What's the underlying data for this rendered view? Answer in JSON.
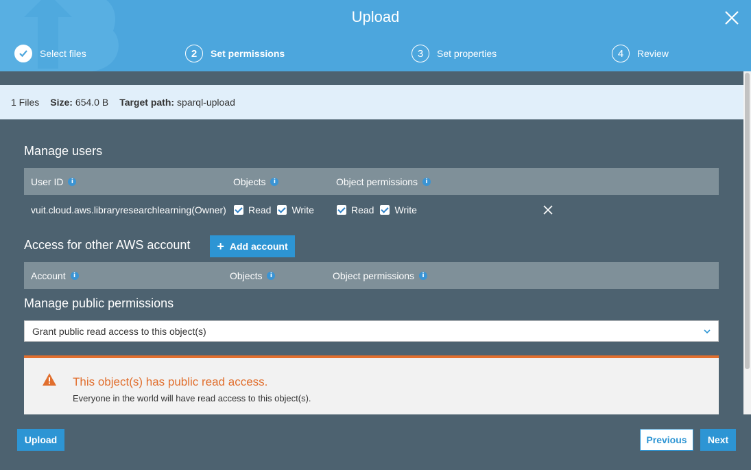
{
  "header": {
    "title": "Upload",
    "steps": [
      {
        "number": "",
        "label": "Select files",
        "state": "done"
      },
      {
        "number": "2",
        "label": "Set permissions",
        "state": "active"
      },
      {
        "number": "3",
        "label": "Set properties",
        "state": "pending"
      },
      {
        "number": "4",
        "label": "Review",
        "state": "pending"
      }
    ]
  },
  "infobar": {
    "files": "1 Files",
    "size_label": "Size:",
    "size_value": "654.0 B",
    "target_label": "Target path:",
    "target_value": "sparql-upload"
  },
  "manage_users": {
    "title": "Manage users",
    "columns": [
      "User ID",
      "Objects",
      "Object permissions"
    ],
    "rows": [
      {
        "user_id": "vuit.cloud.aws.libraryresearchlearning(Owner)",
        "objects_read": "Read",
        "objects_write": "Write",
        "perm_read": "Read",
        "perm_write": "Write"
      }
    ]
  },
  "other_accounts": {
    "title": "Access for other AWS account",
    "add_button": "Add account",
    "columns": [
      "Account",
      "Objects",
      "Object permissions"
    ]
  },
  "public_permissions": {
    "title": "Manage public permissions",
    "selected": "Grant public read access to this object(s)"
  },
  "warning": {
    "title": "This object(s) has public read access.",
    "text": "Everyone in the world will have read access to this object(s)."
  },
  "footer": {
    "upload": "Upload",
    "previous": "Previous",
    "next": "Next"
  },
  "colors": {
    "header": "#4ca6dd",
    "body": "#4d6270",
    "accent": "#2d95d4",
    "warning": "#e16f2e"
  }
}
